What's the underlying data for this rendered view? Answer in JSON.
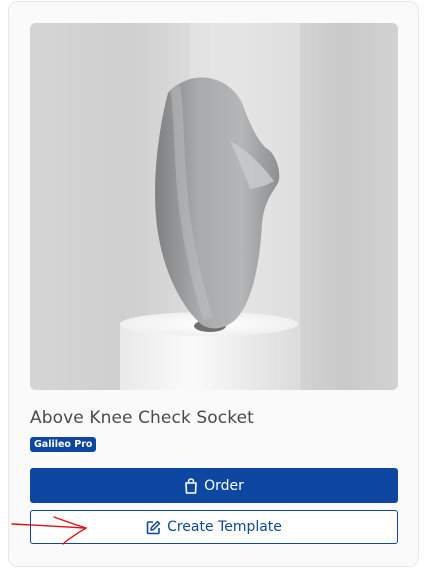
{
  "product": {
    "title": "Above Knee Check Socket",
    "badge": "Galileo Pro",
    "image_alt": "Above knee check socket 3D print on a white pedestal"
  },
  "actions": {
    "order_label": "Order",
    "order_icon": "shopping-bag-icon",
    "template_label": "Create Template",
    "template_icon": "edit-square-icon"
  },
  "colors": {
    "primary": "#0d47a1",
    "annotation": "#e01010"
  }
}
